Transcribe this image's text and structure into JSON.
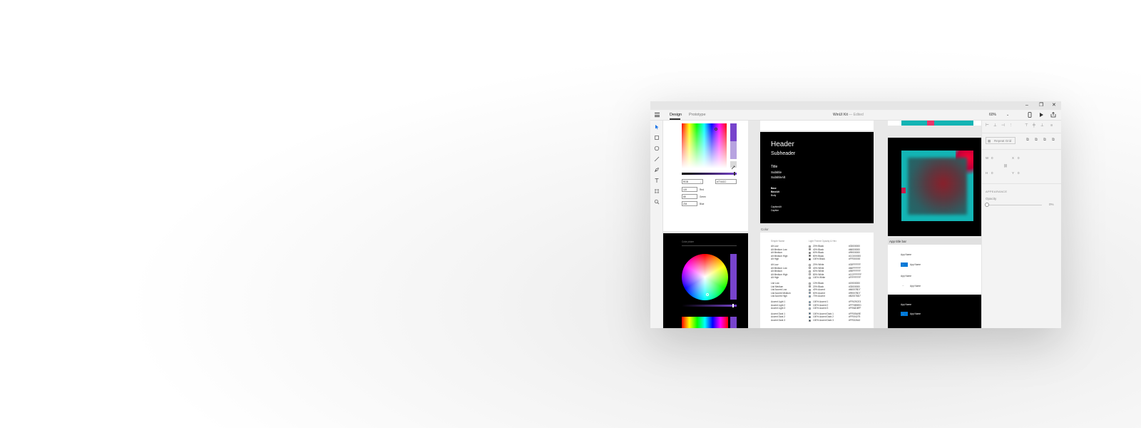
{
  "window": {
    "title": "WinUI Kit",
    "title_sep": "—",
    "status": "Edited",
    "controls": {
      "minimize": "–",
      "restore": "❐",
      "close": "✕"
    }
  },
  "tabs": [
    {
      "label": "Design",
      "active": true
    },
    {
      "label": "Prototype",
      "active": false
    }
  ],
  "zoom": {
    "value": "60%",
    "chevron": "⌄"
  },
  "topbar_icons": [
    "device-preview-icon",
    "play-icon",
    "share-icon"
  ],
  "tools": [
    "select-icon",
    "rectangle-icon",
    "ellipse-icon",
    "line-icon",
    "pen-icon",
    "text-icon",
    "artboard-icon",
    "zoom-icon"
  ],
  "color_picker": {
    "format": "RGB",
    "hex": "#7744CC",
    "channels": [
      {
        "value": "119",
        "label": "Red"
      },
      {
        "value": "68",
        "label": "Green"
      },
      {
        "value": "204",
        "label": "Blue"
      }
    ],
    "accent": "#7744CC"
  },
  "dark_picker": {
    "label": "Color picker"
  },
  "type_ramp": {
    "header": "Header",
    "subheader": "Subheader",
    "title": "Title",
    "subtitle": "Subtitle",
    "subtitle_alt": "SubtitleAlt",
    "base": "Base",
    "base_alt": "BaseAlt",
    "body": "Body",
    "caption_alt": "CaptionAlt",
    "caption": "Caption"
  },
  "section_labels": {
    "color": "Color",
    "app_title_bar": "App title bar"
  },
  "color_table": {
    "headers": [
      "Simple Name",
      "Light Theme Opacity & Hex"
    ],
    "groups": [
      [
        {
          "name": "Alt Low",
          "pct": "20% Black",
          "hex": "#33000000"
        },
        {
          "name": "Alt Medium Low",
          "pct": "40% Black",
          "hex": "#66000000"
        },
        {
          "name": "Alt Medium",
          "pct": "60% Black",
          "hex": "#99000000"
        },
        {
          "name": "Alt Medium High",
          "pct": "80% Black",
          "hex": "#CC000000"
        },
        {
          "name": "Alt High",
          "pct": "100% Black",
          "hex": "#FF000000"
        }
      ],
      [
        {
          "name": "Alt Low",
          "pct": "20% White",
          "hex": "#33FFFFFF"
        },
        {
          "name": "Alt Medium Low",
          "pct": "40% White",
          "hex": "#66FFFFFF"
        },
        {
          "name": "Alt Medium",
          "pct": "60% White",
          "hex": "#99FFFFFF"
        },
        {
          "name": "Alt Medium High",
          "pct": "80% White",
          "hex": "#CCFFFFFF"
        },
        {
          "name": "Alt High",
          "pct": "100% White",
          "hex": "#FFFFFFFF"
        }
      ],
      [
        {
          "name": "List Low",
          "pct": "10% Black",
          "hex": "#19000000"
        },
        {
          "name": "List Medium",
          "pct": "20% Black",
          "hex": "#33000000"
        },
        {
          "name": "List Accent Low",
          "pct": "40% Accent",
          "hex": "#660078D7"
        },
        {
          "name": "List Accent Medium",
          "pct": "60% Accent",
          "hex": "#990078D7"
        },
        {
          "name": "List Accent High",
          "pct": "70% Accent",
          "hex": "#B20078D7"
        }
      ],
      [
        {
          "name": "Accent Light 1",
          "pct": "100% Accent 1",
          "hex": "#FF429CE3"
        },
        {
          "name": "Accent Light 2",
          "pct": "100% Accent 2",
          "hex": "#FF76B9ED"
        },
        {
          "name": "Accent Light 3",
          "pct": "100% Accent 3",
          "hex": "#FFA6D8FF"
        }
      ],
      [
        {
          "name": "Accent Dark 1",
          "pct": "100% Accent Dark 1",
          "hex": "#FF005A9E"
        },
        {
          "name": "Accent Dark 2",
          "pct": "100% Accent Dark 2",
          "hex": "#FF004275"
        },
        {
          "name": "Accent Dark 3",
          "pct": "100% Accent Dark 3",
          "hex": "#FF002642"
        }
      ]
    ]
  },
  "title_bar_demos": {
    "app_name": "App Name",
    "app_name_light": "App Name",
    "app_name_with_icon": "App Name",
    "app_name_dark": "App Name",
    "back_icon": "←"
  },
  "inspector": {
    "repeat_grid": "Repeat Grid",
    "w": "W",
    "w_val": "0",
    "h": "H",
    "h_val": "0",
    "x": "X",
    "x_val": "0",
    "y": "Y",
    "y_val": "0",
    "appearance": "APPEARANCE",
    "opacity": "Opacity",
    "opacity_val": "0%",
    "link_icon": "⛓"
  },
  "colors": {
    "accent_blue": "#0078D7",
    "teal": "#13B4B4",
    "dark": "#000000"
  }
}
